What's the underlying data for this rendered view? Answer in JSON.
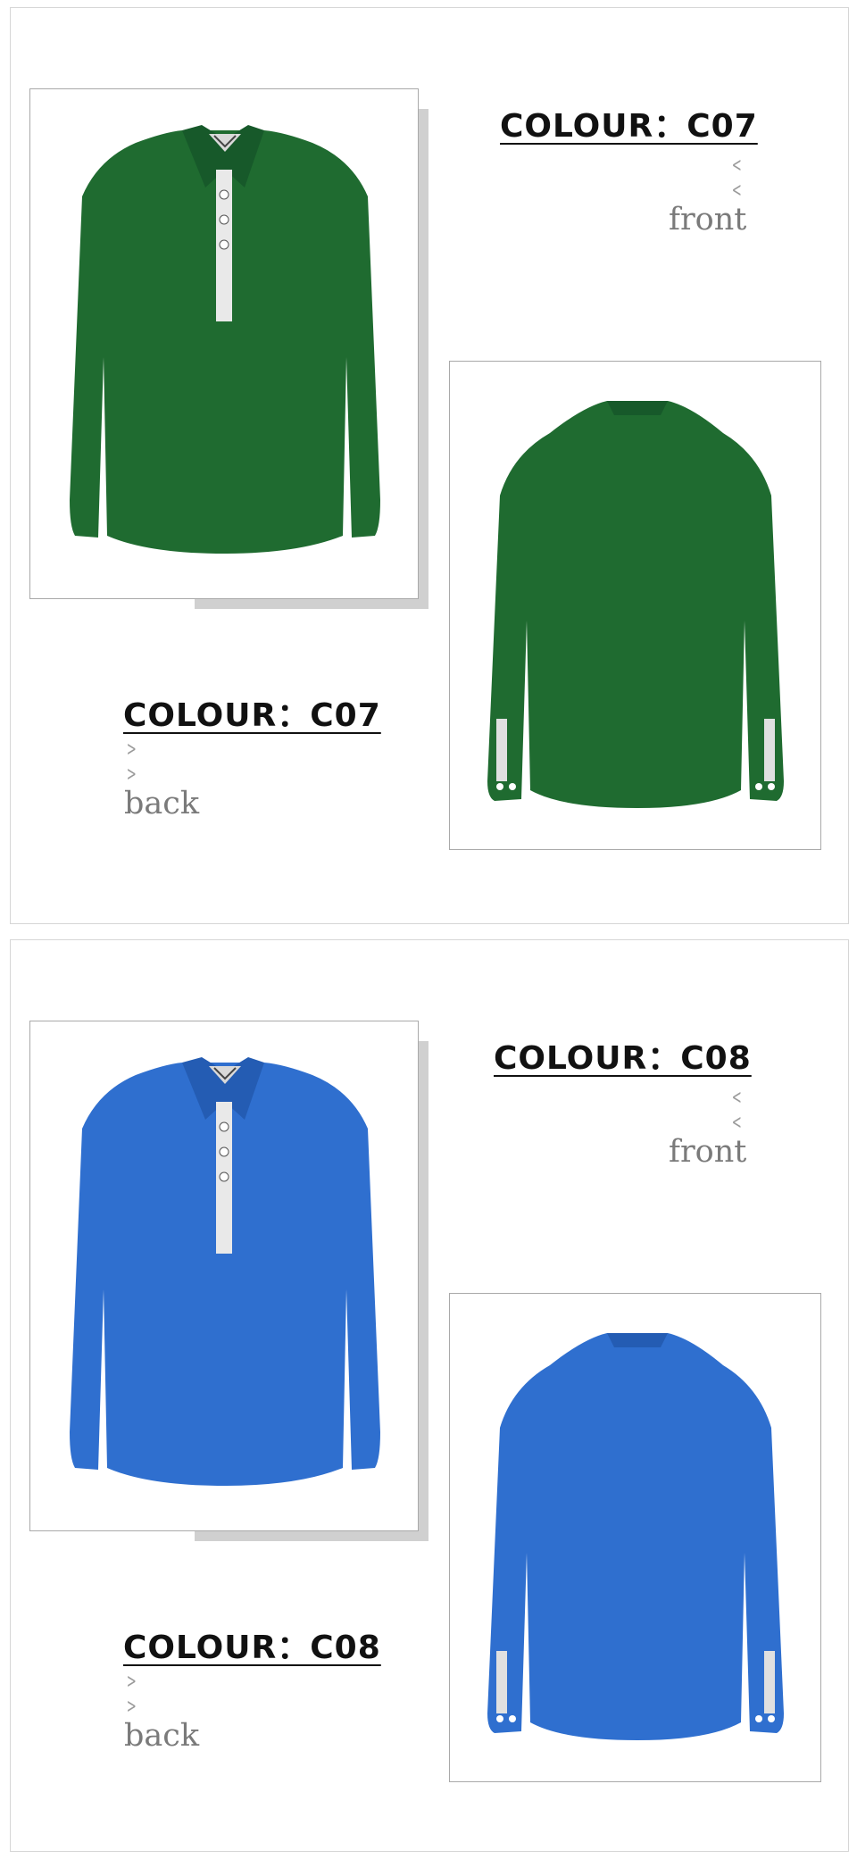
{
  "sections": [
    {
      "front_heading": "COLOUR：C07",
      "front_word": "front",
      "back_heading": "COLOUR：C07",
      "back_word": "back",
      "shirt_color": "#1f6b30",
      "shirt_shade": "#17592a"
    },
    {
      "front_heading": "COLOUR：C08",
      "front_word": "front",
      "back_heading": "COLOUR：C08",
      "back_word": "back",
      "shirt_color": "#2f6fcf",
      "shirt_shade": "#245cb3"
    }
  ],
  "icons": {
    "front_arrow": "chevron-left-icon",
    "back_arrow": "chevron-right-icon"
  }
}
